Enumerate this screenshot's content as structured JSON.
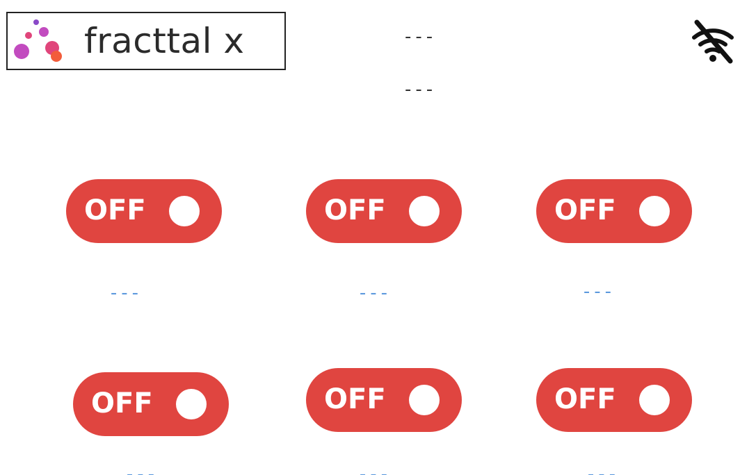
{
  "header": {
    "logo_text": "fracttal x",
    "status_line_1": "---",
    "status_line_2": "---",
    "connection_icon": "wifi-off-icon"
  },
  "colors": {
    "toggle_off": "#e04540",
    "caption": "#5b98dd",
    "logo_dots": [
      "#8a49c8",
      "#c24bbf",
      "#e0457b",
      "#f25c3b"
    ]
  },
  "switches": [
    {
      "state": "OFF",
      "caption": "---"
    },
    {
      "state": "OFF",
      "caption": "---"
    },
    {
      "state": "OFF",
      "caption": "---"
    },
    {
      "state": "OFF",
      "caption": "---"
    },
    {
      "state": "OFF",
      "caption": "---"
    },
    {
      "state": "OFF",
      "caption": "---"
    }
  ]
}
